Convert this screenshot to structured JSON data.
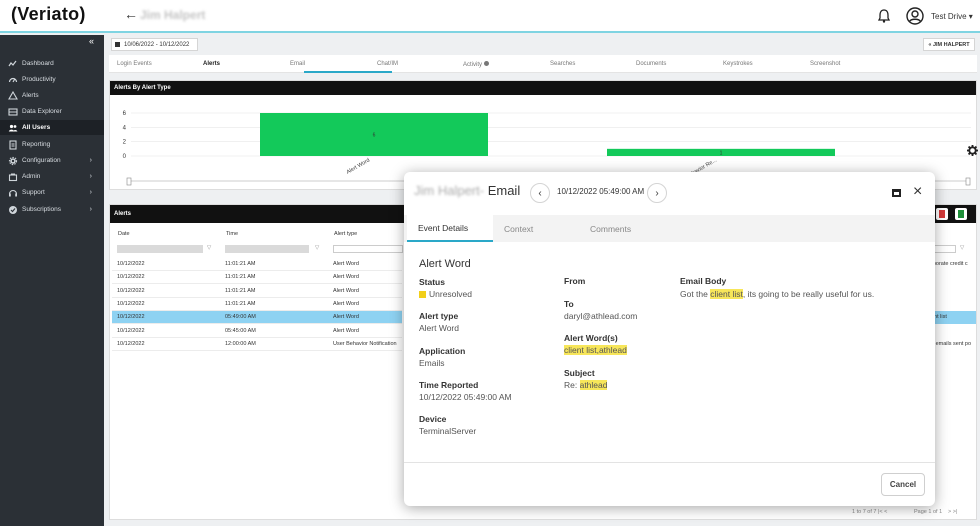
{
  "header": {
    "logo": "(Veriato)",
    "user_name": "Jim Halpert",
    "account": "Test Drive"
  },
  "sidebar": {
    "items": [
      {
        "label": "Dashboard",
        "icon": "chart-line-icon",
        "chevron": false
      },
      {
        "label": "Productivity",
        "icon": "gauge-icon",
        "chevron": false
      },
      {
        "label": "Alerts",
        "icon": "alert-icon",
        "chevron": false
      },
      {
        "label": "Data Explorer",
        "icon": "table-icon",
        "chevron": false
      },
      {
        "label": "All Users",
        "icon": "users-icon",
        "chevron": false,
        "active": true
      },
      {
        "label": "Reporting",
        "icon": "report-icon",
        "chevron": false
      },
      {
        "label": "Configuration",
        "icon": "gear-icon",
        "chevron": true
      },
      {
        "label": "Admin",
        "icon": "admin-icon",
        "chevron": true
      },
      {
        "label": "Support",
        "icon": "support-icon",
        "chevron": true
      },
      {
        "label": "Subscriptions",
        "icon": "check-circle-icon",
        "chevron": true
      }
    ]
  },
  "toolbar": {
    "date_range": "10/06/2022 - 10/12/2022",
    "user_button": "« JIM HALPERT"
  },
  "tabs": [
    "Login Events",
    "Alerts",
    "Email",
    "Chat/IM",
    "Activity",
    "Searches",
    "Documents",
    "Keystrokes",
    "Screenshot"
  ],
  "chart_panel": {
    "title": "Alerts By Alert Type"
  },
  "chart_data": {
    "type": "bar",
    "categories": [
      "Alert Word",
      "User Behavior Re..."
    ],
    "values": [
      6,
      1
    ],
    "ylim": [
      0,
      6
    ],
    "yticks": [
      0,
      2,
      4,
      6
    ],
    "data_labels": [
      "6",
      "1"
    ],
    "bar_color": "#13c95a"
  },
  "alerts_panel": {
    "title": "Alerts",
    "columns": [
      "Date",
      "Time",
      "Alert type"
    ],
    "rows": [
      {
        "date": "10/12/2022",
        "time": "11:01:21 AM",
        "type": "Alert Word",
        "extra": "rporate credit c"
      },
      {
        "date": "10/12/2022",
        "time": "11:01:21 AM",
        "type": "Alert Word",
        "extra": ""
      },
      {
        "date": "10/12/2022",
        "time": "11:01:21 AM",
        "type": "Alert Word",
        "extra": ""
      },
      {
        "date": "10/12/2022",
        "time": "11:01:21 AM",
        "type": "Alert Word",
        "extra": ""
      },
      {
        "date": "10/12/2022",
        "time": "05:49:00 AM",
        "type": "Alert Word",
        "extra": "ent list",
        "selected": true
      },
      {
        "date": "10/12/2022",
        "time": "05:45:00 AM",
        "type": "Alert Word",
        "extra": ""
      },
      {
        "date": "10/12/2022",
        "time": "12:00:00 AM",
        "type": "User Behavior Notification",
        "extra": "d emails sent po"
      }
    ],
    "pager_text": "1 to 7 of 7",
    "page_text": "Page 1 of 1"
  },
  "modal": {
    "title_name": "Jim Halpert-",
    "title": "Email",
    "datetime": "10/12/2022 05:49:00 AM",
    "tabs": [
      "Event Details",
      "Context",
      "Comments"
    ],
    "heading": "Alert Word",
    "status_label": "Status",
    "status_value": "Unresolved",
    "status_color": "#f2cf1a",
    "alert_type_label": "Alert type",
    "alert_type_value": "Alert Word",
    "application_label": "Application",
    "application_value": "Emails",
    "time_reported_label": "Time Reported",
    "time_reported_value": "10/12/2022 05:49:00 AM",
    "device_label": "Device",
    "device_value": "TerminalServer",
    "from_label": "From",
    "to_label": "To",
    "to_value": "daryl@athlead.com",
    "alert_words_label": "Alert Word(s)",
    "alert_words_value": "client list,athlead",
    "subject_label": "Subject",
    "subject_prefix": "Re: ",
    "subject_highlight": "athlead",
    "email_body_label": "Email Body",
    "email_body_before": "Got the ",
    "email_body_highlight": "client list",
    "email_body_after": ", its going to be really useful for us.",
    "cancel_label": "Cancel"
  }
}
